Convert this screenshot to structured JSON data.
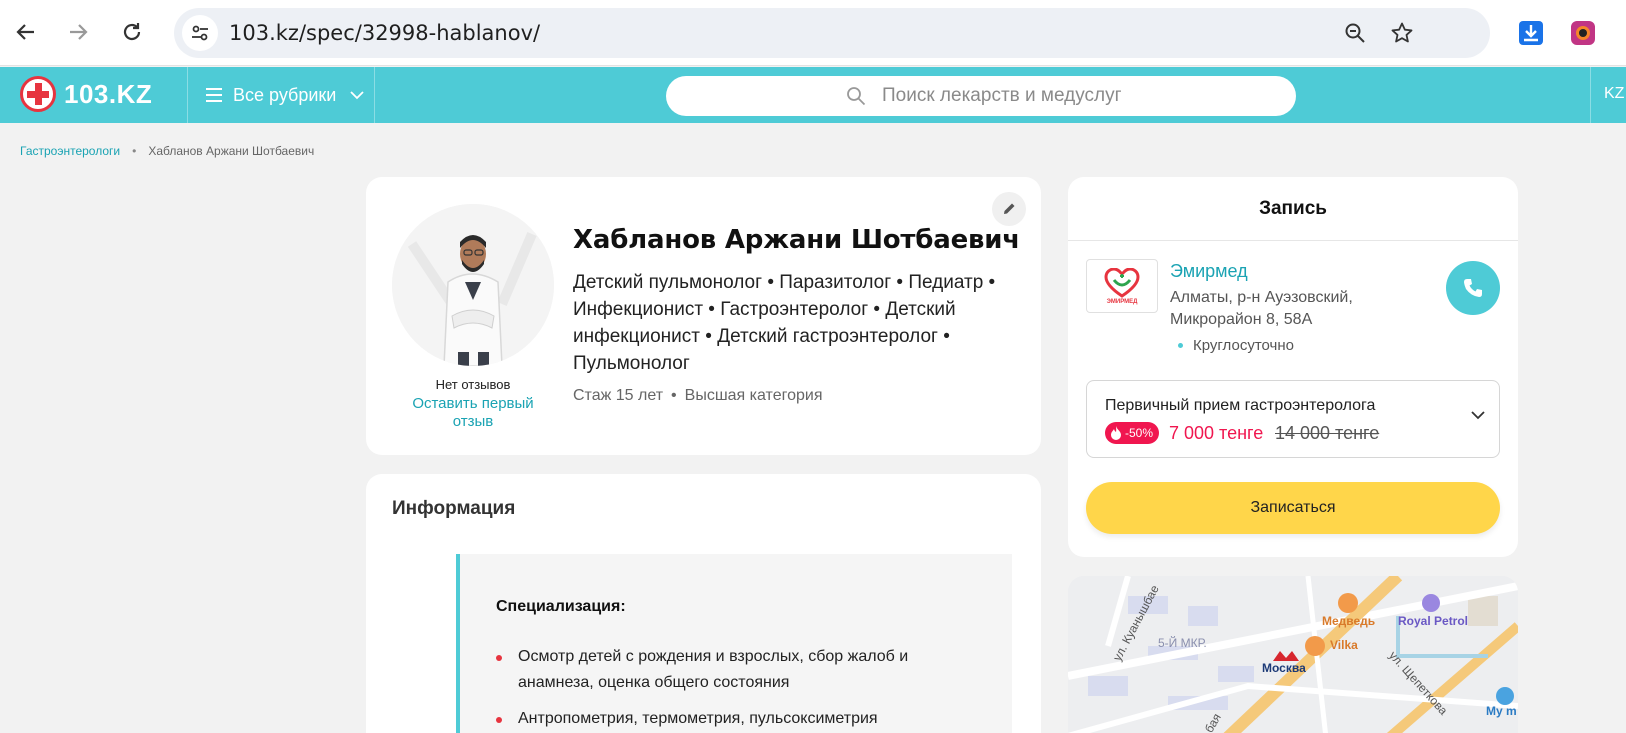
{
  "browser": {
    "url": "103.kz/spec/32998-hablanov/"
  },
  "header": {
    "logo_text": "103.KZ",
    "rubrics_label": "Все рубрики",
    "search_placeholder": "Поиск лекарств и медуслуг",
    "lang": "KZ",
    "accent_color": "#4ecbd6"
  },
  "breadcrumb": {
    "items": [
      "Гастроэнтерологи",
      "Хабланов Аржани Шотбаевич"
    ]
  },
  "doctor": {
    "name": "Хабланов Аржани Шотбаевич",
    "specialties": "Детский пульмонолог • Паразитолог • Педиатр • Инфекционист • Гастроэнтеролог • Детский инфекционист • Детский гастроэнтеролог • Пульмонолог",
    "experience": "Стаж 15 лет",
    "separator": "•",
    "category": "Высшая категория",
    "no_reviews": "Нет отзывов",
    "leave_review": "Оставить первый отзыв"
  },
  "info": {
    "title": "Информация",
    "subtitle": "Специализация:",
    "items": [
      "Осмотр детей с рождения и взрослых, сбор жалоб и анамнеза, оценка общего состояния",
      "Антропометрия, термометрия, пульсоксиметрия"
    ]
  },
  "booking": {
    "title": "Запись",
    "clinic_logo_text": "ЭМИРМЕД",
    "clinic_name": "Эмирмед",
    "clinic_address": "Алматы, р-н Ауэзовский, Микрорайон 8, 58А",
    "clinic_hours": "Круглосуточно",
    "service": "Первичный прием гастроэнтеролога",
    "discount": "-50%",
    "price_new": "7 000 тенге",
    "price_old": "14 000 тенге",
    "book_button": "Записаться"
  },
  "map": {
    "labels": [
      "ул. Куанышбае",
      "5-Й МКР.",
      "Медведь",
      "Vilka",
      "Москва",
      "Royal Petrol",
      "ул. Щепеткова",
      "Мy m",
      "бая"
    ]
  }
}
